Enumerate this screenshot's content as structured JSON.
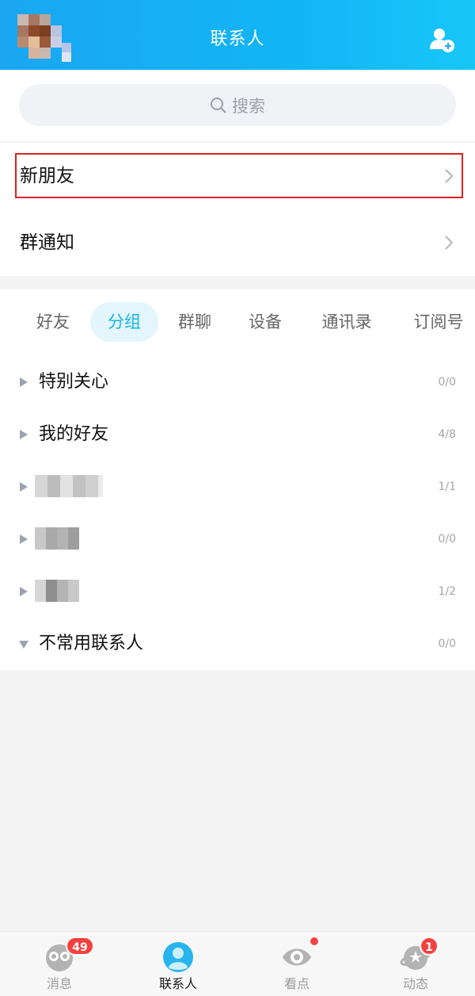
{
  "header": {
    "title": "联系人"
  },
  "search": {
    "placeholder": "搜索"
  },
  "entries": [
    {
      "label": "新朋友"
    },
    {
      "label": "群通知"
    }
  ],
  "tabs": [
    {
      "label": "好友",
      "active": false
    },
    {
      "label": "分组",
      "active": true
    },
    {
      "label": "群聊",
      "active": false
    },
    {
      "label": "设备",
      "active": false
    },
    {
      "label": "通讯录",
      "active": false
    },
    {
      "label": "订阅号",
      "active": false
    }
  ],
  "groups": [
    {
      "name": "特别关心",
      "count": "0/0",
      "expanded": false
    },
    {
      "name": "我的好友",
      "count": "4/8",
      "expanded": false
    },
    {
      "name": "",
      "count": "1/1",
      "expanded": false
    },
    {
      "name": "",
      "count": "0/0",
      "expanded": false
    },
    {
      "name": "",
      "count": "1/2",
      "expanded": false
    },
    {
      "name": "不常用联系人",
      "count": "0/0",
      "expanded": true
    }
  ],
  "bottom_nav": [
    {
      "label": "消息",
      "icon": "messages-icon",
      "badge": "49",
      "active": false
    },
    {
      "label": "联系人",
      "icon": "contacts-icon",
      "active": true
    },
    {
      "label": "看点",
      "icon": "eye-icon",
      "dot": true,
      "active": false
    },
    {
      "label": "动态",
      "icon": "planet-icon",
      "badge": "1",
      "active": false
    }
  ],
  "colors": {
    "header_gradient_start": "#1aa6f2",
    "accent": "#1ab3e6",
    "badge": "#f3423f",
    "highlight_border": "#e02020"
  }
}
